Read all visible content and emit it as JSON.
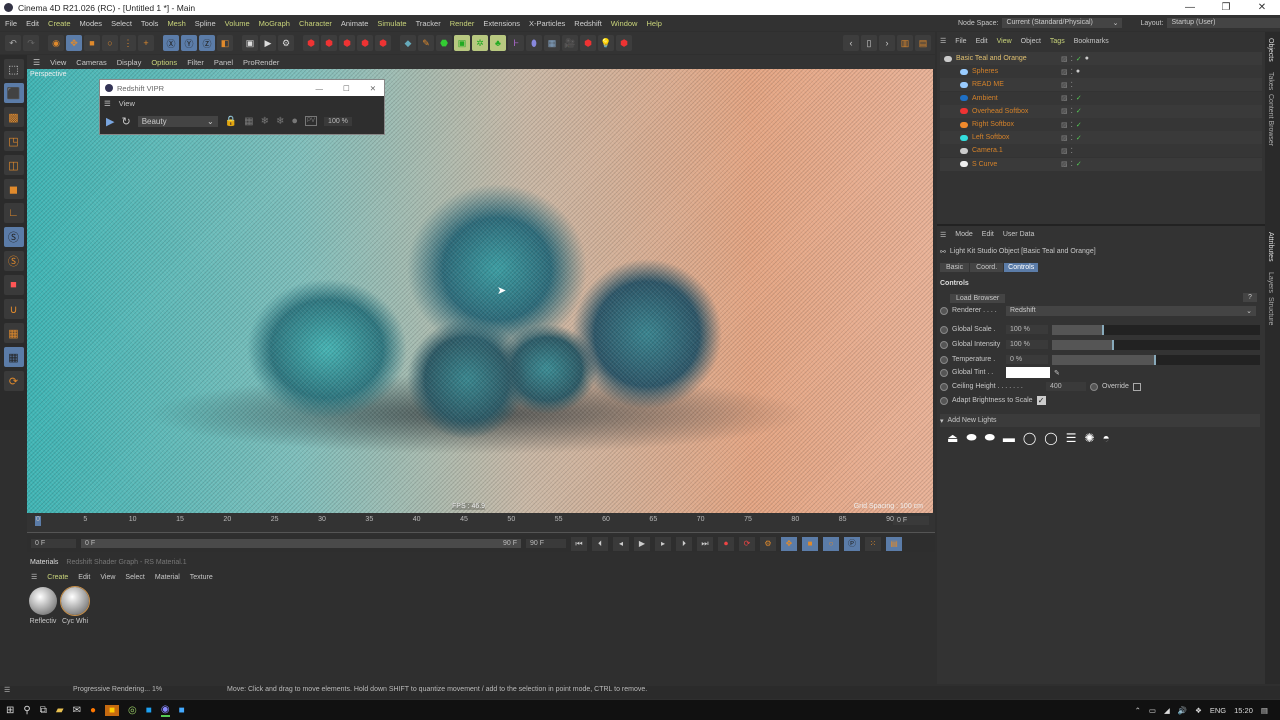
{
  "window": {
    "title": "Cinema 4D R21.026 (RC) - [Untitled 1 *] - Main",
    "controls": [
      "—",
      "❐",
      "✕"
    ]
  },
  "menubar": [
    {
      "l": "File"
    },
    {
      "l": "Edit"
    },
    {
      "l": "Create",
      "g": 1
    },
    {
      "l": "Modes"
    },
    {
      "l": "Select"
    },
    {
      "l": "Tools"
    },
    {
      "l": "Mesh",
      "g": 1
    },
    {
      "l": "Spline"
    },
    {
      "l": "Volume",
      "g": 1
    },
    {
      "l": "MoGraph",
      "g": 1
    },
    {
      "l": "Character",
      "g": 1
    },
    {
      "l": "Animate"
    },
    {
      "l": "Simulate",
      "g": 1
    },
    {
      "l": "Tracker"
    },
    {
      "l": "Render",
      "g": 1
    },
    {
      "l": "Extensions"
    },
    {
      "l": "X-Particles"
    },
    {
      "l": "Redshift"
    },
    {
      "l": "Window",
      "g": 1
    },
    {
      "l": "Help",
      "g": 1
    }
  ],
  "node_space": {
    "label": "Node Space:",
    "value": "Current (Standard/Physical)"
  },
  "layout": {
    "label": "Layout:",
    "value": "Startup (User)"
  },
  "viewport": {
    "menu": [
      "View",
      "Cameras",
      "Display",
      "Options",
      "Filter",
      "Panel",
      "ProRender"
    ],
    "label": "Perspective",
    "grid_spacing": "Grid Spacing : 100 cm",
    "fps": "FPS : 46.9"
  },
  "vipr": {
    "title": "Redshift VIPR",
    "menu": "View",
    "aov": "Beauty",
    "zoom": "100 %",
    "aux": "PV"
  },
  "timeline": {
    "ticks": [
      "0",
      "5",
      "10",
      "15",
      "20",
      "25",
      "30",
      "35",
      "40",
      "45",
      "50",
      "55",
      "60",
      "65",
      "70",
      "75",
      "80",
      "85",
      "90"
    ],
    "current": "0 F",
    "start": "0 F",
    "range_start": "0 F",
    "range_end": "90 F",
    "end": "90 F"
  },
  "materials": {
    "tabs": [
      "Materials",
      "Redshift Shader Graph - RS Material.1"
    ],
    "menu": [
      "Create",
      "Edit",
      "View",
      "Select",
      "Material",
      "Texture"
    ],
    "items": [
      "Reflectiv",
      "Cyc Whi"
    ]
  },
  "status": {
    "left": "Progressive Rendering... 1%",
    "hint": "Move: Click and drag to move elements. Hold down SHIFT to quantize movement / add to the selection in point mode, CTRL to remove."
  },
  "objects": {
    "menu": [
      "File",
      "Edit",
      "View",
      "Object",
      "Tags",
      "Bookmarks"
    ],
    "items": [
      {
        "name": "Basic Teal and Orange",
        "color": "#e0c070",
        "icon": "#ccc"
      },
      {
        "name": "Spheres",
        "color": "#d4822a",
        "icon": "#9cf"
      },
      {
        "name": "READ ME",
        "color": "#d4822a",
        "icon": "#9cf"
      },
      {
        "name": "Ambient",
        "color": "#d4822a",
        "icon": "#1e6fc4"
      },
      {
        "name": "Overhead Softbox",
        "color": "#d4822a",
        "icon": "#e33"
      },
      {
        "name": "Right Softbox",
        "color": "#d4822a",
        "icon": "#f08a2c"
      },
      {
        "name": "Left Softbox",
        "color": "#d4822a",
        "icon": "#3dd"
      },
      {
        "name": "Camera.1",
        "color": "#d4822a",
        "icon": "#ccc"
      },
      {
        "name": "S Curve",
        "color": "#d4822a",
        "icon": "#eee"
      }
    ]
  },
  "attributes": {
    "menu": [
      "Mode",
      "Edit",
      "User Data"
    ],
    "object": "Light Kit Studio Object [Basic Teal and Orange]",
    "tabs": [
      "Basic",
      "Coord.",
      "Controls"
    ],
    "section": "Controls",
    "load_browser": "Load Browser",
    "help": "?",
    "renderer": {
      "label": "Renderer . . . .",
      "value": "Redshift"
    },
    "global_scale": {
      "label": "Global Scale .",
      "value": "100 %",
      "fraction": 0.25
    },
    "global_intensity": {
      "label": "Global Intensity",
      "value": "100 %",
      "fraction": 0.3
    },
    "temperature": {
      "label": "Temperature .",
      "value": "0 %",
      "fraction": 0.5
    },
    "global_tint": {
      "label": "Global Tint . .",
      "color": "#ffffff"
    },
    "ceiling": {
      "label": "Ceiling Height . . . . . . .",
      "value": "400",
      "override": "Override"
    },
    "adapt": {
      "label": "Adapt Brightness to Scale",
      "checked": true
    },
    "add_lights": "Add New Lights"
  },
  "side_tabs": [
    "Objects",
    "Takes",
    "Content Browser",
    "Attributes",
    "Layers",
    "Structure"
  ],
  "tray": {
    "lang": "ENG",
    "time": "15:20"
  }
}
